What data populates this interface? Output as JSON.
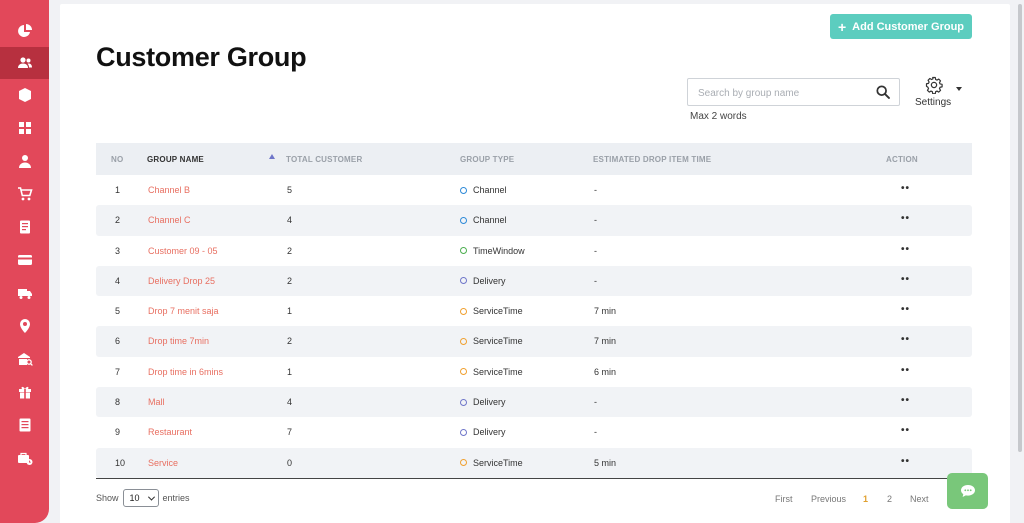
{
  "header": {
    "title": "Customer Group",
    "add_button_label": "Add Customer Group"
  },
  "search": {
    "placeholder": "Search by group name",
    "value": "",
    "hint": "Max 2 words"
  },
  "settings": {
    "label": "Settings"
  },
  "table": {
    "columns": [
      "NO",
      "GROUP NAME",
      "TOTAL CUSTOMER",
      "GROUP TYPE",
      "ESTIMATED DROP ITEM TIME",
      "ACTION"
    ],
    "sorted_column": "GROUP NAME",
    "sort_direction": "ascending",
    "rows": [
      {
        "no": "1",
        "name": "Channel B",
        "total": "5",
        "type": "Channel",
        "type_color": "#2e8ad8",
        "drop": "-",
        "action": "••"
      },
      {
        "no": "2",
        "name": "Channel C",
        "total": "4",
        "type": "Channel",
        "type_color": "#2e8ad8",
        "drop": "-",
        "action": "••"
      },
      {
        "no": "3",
        "name": "Customer 09 - 05",
        "total": "2",
        "type": "TimeWindow",
        "type_color": "#4cae4f",
        "drop": "-",
        "action": "••"
      },
      {
        "no": "4",
        "name": "Delivery Drop 25",
        "total": "2",
        "type": "Delivery",
        "type_color": "#6f76c9",
        "drop": "-",
        "action": "••"
      },
      {
        "no": "5",
        "name": "Drop 7 menit saja",
        "total": "1",
        "type": "ServiceTime",
        "type_color": "#f0a030",
        "drop": "7 min",
        "action": "••"
      },
      {
        "no": "6",
        "name": "Drop time 7min",
        "total": "2",
        "type": "ServiceTime",
        "type_color": "#f0a030",
        "drop": "7 min",
        "action": "••"
      },
      {
        "no": "7",
        "name": "Drop time in 6mins",
        "total": "1",
        "type": "ServiceTime",
        "type_color": "#f0a030",
        "drop": "6 min",
        "action": "••"
      },
      {
        "no": "8",
        "name": "Mall",
        "total": "4",
        "type": "Delivery",
        "type_color": "#6f76c9",
        "drop": "-",
        "action": "••"
      },
      {
        "no": "9",
        "name": "Restaurant",
        "total": "7",
        "type": "Delivery",
        "type_color": "#6f76c9",
        "drop": "-",
        "action": "••"
      },
      {
        "no": "10",
        "name": "Service",
        "total": "0",
        "type": "ServiceTime",
        "type_color": "#f0a030",
        "drop": "5 min",
        "action": "••"
      }
    ]
  },
  "footer": {
    "show_label": "Show",
    "entries_value": "10",
    "entries_label": "entries",
    "pagination": {
      "first": "First",
      "previous": "Previous",
      "pages": [
        "1",
        "2"
      ],
      "current_page": "1",
      "next": "Next"
    }
  },
  "sidebar": {
    "active_index": 1,
    "items": [
      "dashboard-icon",
      "customers-icon",
      "box-icon",
      "grid-icon",
      "user-icon",
      "cart-icon",
      "report-icon",
      "card-icon",
      "truck-icon",
      "location-icon",
      "warehouse-search-icon",
      "gift-icon",
      "list-icon",
      "briefcase-icon"
    ]
  },
  "colors": {
    "sidebar": "#e2485a",
    "sidebar_active": "#b7303f",
    "accent_button": "#5ccdbf",
    "link": "#e86f61",
    "chat_button": "#79c77a"
  }
}
